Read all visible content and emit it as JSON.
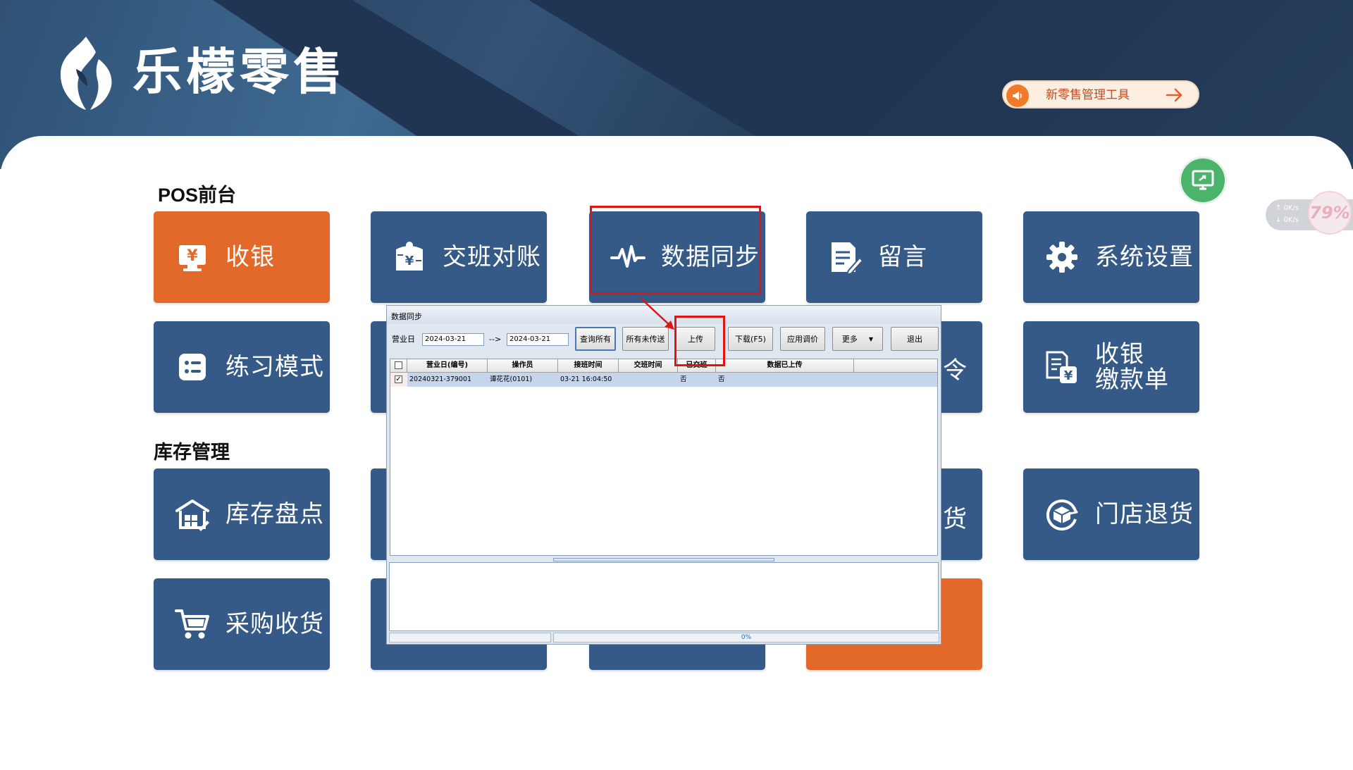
{
  "app": {
    "name": "乐檬零售",
    "tool_button_label": "新零售管理工具"
  },
  "sections": {
    "pos": "POS前台",
    "inventory": "库存管理"
  },
  "tiles": {
    "cashier": "收银",
    "shift_reconcile": "交班对账",
    "data_sync": "数据同步",
    "message": "留言",
    "system_settings": "系统设置",
    "practice_mode": "练习模式",
    "partial_cmd": "令",
    "cash_payment_line1": "收银",
    "cash_payment_line2": "缴款单",
    "stock_count": "库存盘点",
    "partial_goods": "货",
    "store_return": "门店退货",
    "purchase_receive": "采购收货"
  },
  "speed_widget": {
    "upload": "0K/s",
    "download": "0K/s",
    "percent": "79%"
  },
  "dialog": {
    "title": "数据同步",
    "business_day_label": "营业日",
    "date_from": "2024-03-21",
    "date_sep": "-->",
    "date_to": "2024-03-21",
    "buttons": {
      "query_all": "查询所有",
      "all_unsent": "所有未传送",
      "upload": "上传",
      "download": "下载(F5)",
      "apply_price": "应用调价",
      "more": "更多",
      "exit": "退出"
    },
    "columns": [
      "营业日(编号)",
      "操作员",
      "接班时间",
      "交班时间",
      "已交班",
      "数据已上传"
    ],
    "rows": [
      {
        "checked": true,
        "business_day": "20240321-379001",
        "operator": "谭花花(0101)",
        "start_time": "03-21 16:04:50",
        "end_time": "",
        "handed_over": "否",
        "uploaded": "否"
      }
    ],
    "progress": "0%"
  },
  "colors": {
    "tile_blue": "#355a87",
    "tile_orange": "#e3692a",
    "header_dark": "#1f3553",
    "highlight_red": "#e11414"
  }
}
